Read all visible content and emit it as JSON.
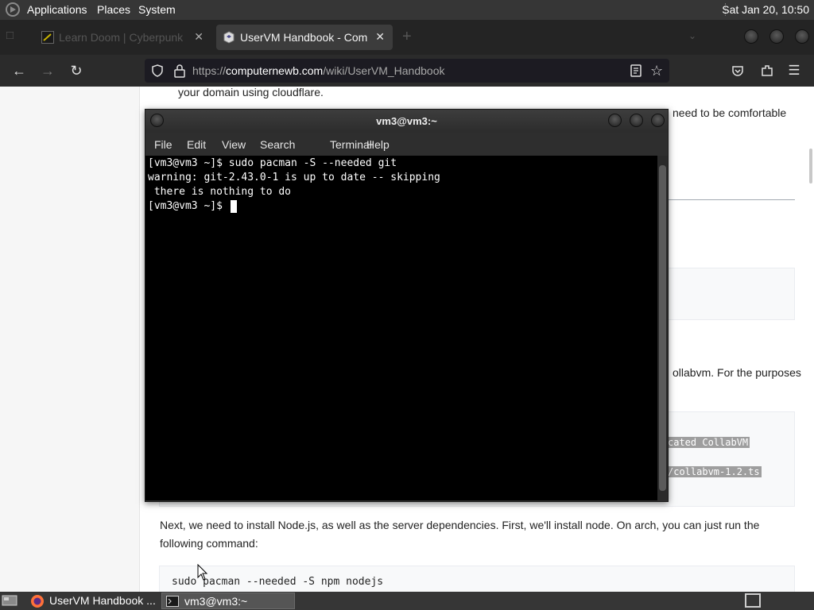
{
  "top_panel": {
    "menus": [
      "Applications",
      "Places",
      "System"
    ],
    "clock": "Sat Jan 20, 10:50"
  },
  "browser": {
    "tabs": [
      {
        "title": "Learn Doom | Cyberpunk",
        "active": false
      },
      {
        "title": "UserVM Handbook - Compu",
        "active": true
      }
    ],
    "url_prefix": "https://",
    "url_host": "computernewb.com",
    "url_path": "/wiki/UserVM_Handbook"
  },
  "page": {
    "line_domain": "your domain using cloudflare.",
    "line_comfortable": "need to be comfortable",
    "line_collabvm": "ollabvm. For the purposes",
    "code_hl_1": "cated CollabVM",
    "code_hl_2": "/collabvm-1.2.ts",
    "para_node_1": "Next, we need to install Node.js, as well as the server dependencies. First, we'll install node. On arch, you can just run the",
    "para_node_2": "following command:",
    "code_pacman": "sudo pacman --needed -S npm nodejs"
  },
  "terminal": {
    "title": "vm3@vm3:~",
    "menus": [
      "File",
      "Edit",
      "View",
      "Search",
      "Terminal",
      "Help"
    ],
    "lines": [
      "[vm3@vm3 ~]$ sudo pacman -S --needed git",
      "warning: git-2.43.0-1 is up to date -- skipping",
      " there is nothing to do",
      "[vm3@vm3 ~]$ "
    ]
  },
  "taskbar": {
    "items": [
      {
        "label": "UserVM Handbook ...",
        "icon": "firefox-icon"
      },
      {
        "label": "vm3@vm3:~",
        "icon": "terminal-icon"
      }
    ]
  }
}
